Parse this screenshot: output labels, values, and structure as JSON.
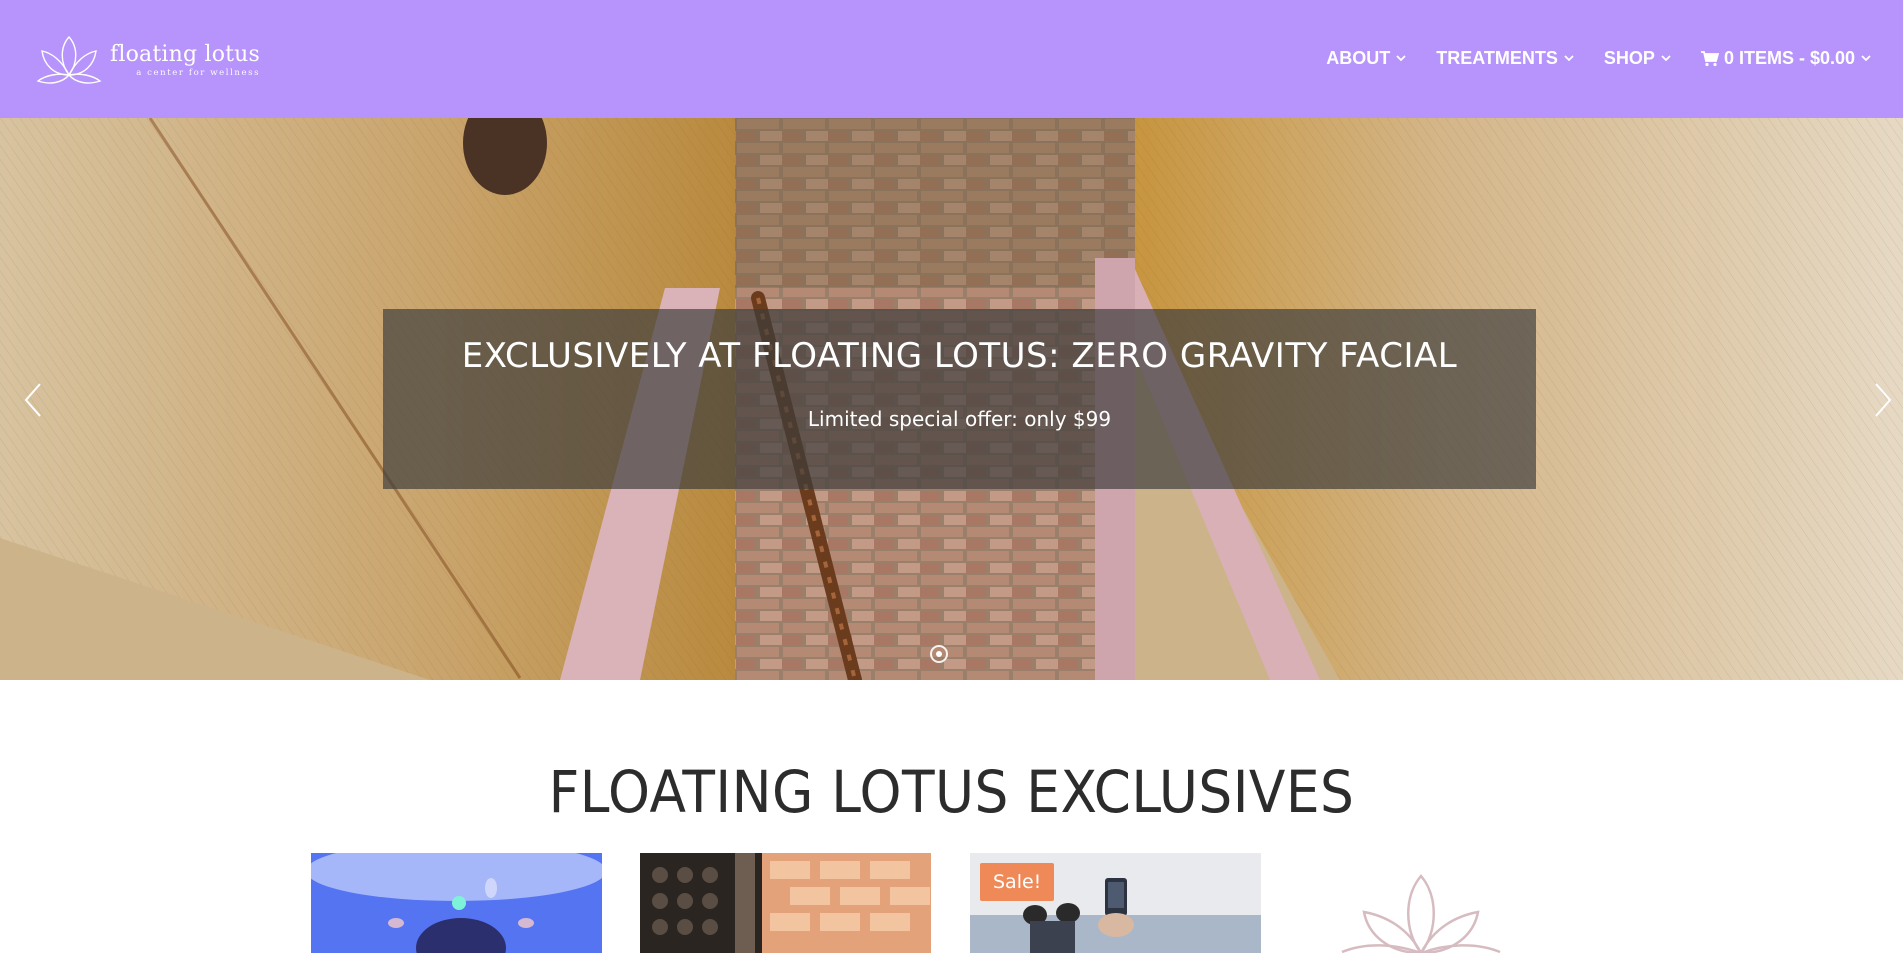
{
  "brand": {
    "name": "floating lotus",
    "tagline": "a center for wellness",
    "header_color": "#b794fb"
  },
  "nav": {
    "items": [
      {
        "label": "ABOUT",
        "icon": "chevron-down-icon"
      },
      {
        "label": "TREATMENTS",
        "icon": "chevron-down-icon"
      },
      {
        "label": "SHOP",
        "icon": "chevron-down-icon"
      }
    ],
    "cart": {
      "label": "0 ITEMS - $0.00",
      "icon": "cart-icon"
    }
  },
  "hero": {
    "title": "EXCLUSIVELY AT FLOATING LOTUS: ZERO GRAVITY FACIAL",
    "subtitle": "Limited special offer: only $99",
    "prev_icon": "chevron-left-icon",
    "next_icon": "chevron-right-icon"
  },
  "exclusives": {
    "title": "FLOATING LOTUS EXCLUSIVES",
    "products": [
      {
        "badge": ""
      },
      {
        "badge": ""
      },
      {
        "badge": "Sale!"
      }
    ],
    "sale_color": "#ef8a58"
  }
}
